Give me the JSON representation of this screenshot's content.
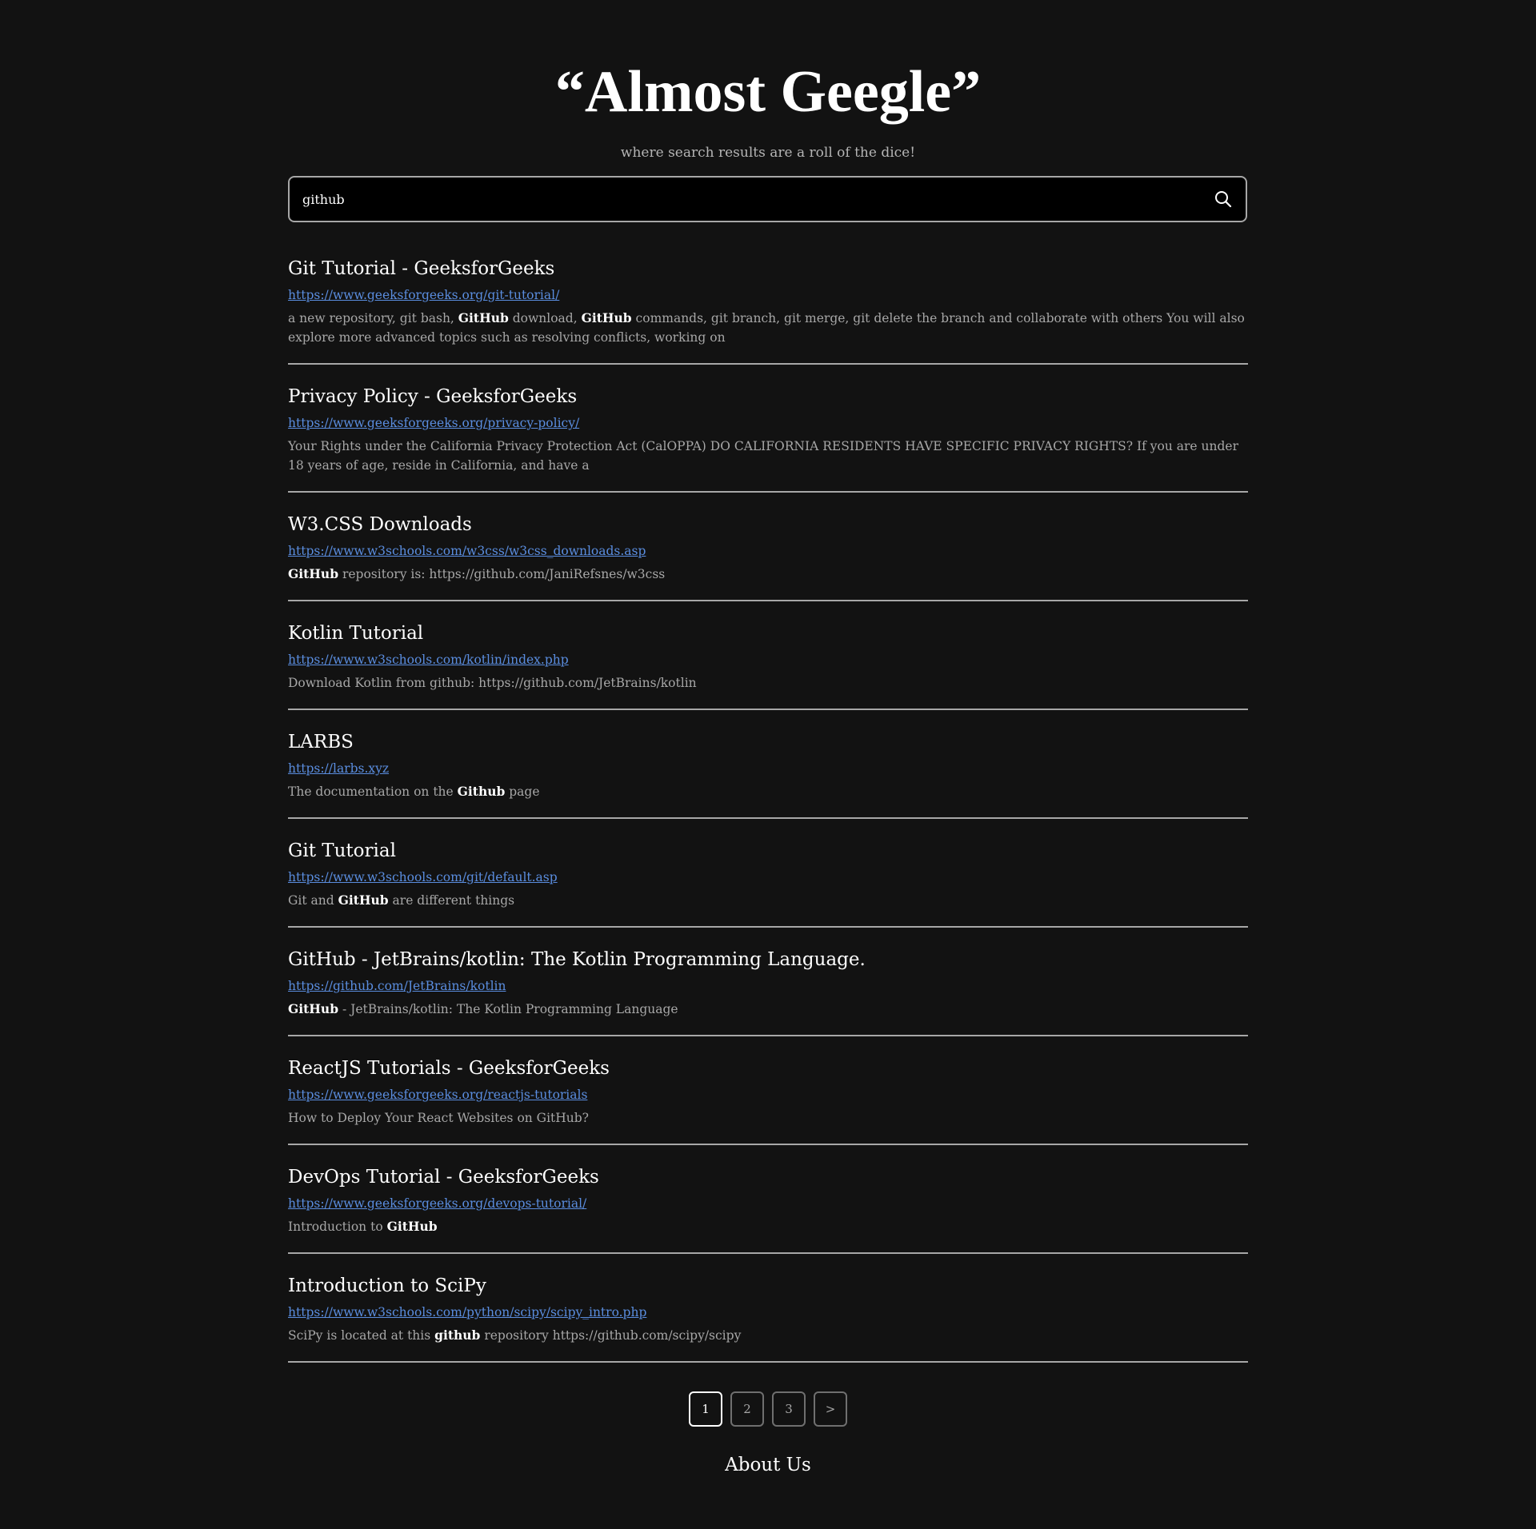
{
  "header": {
    "title": "“Almost Geegle”",
    "tagline": "where search results are a roll of the dice!"
  },
  "search": {
    "value": "github",
    "icon": "search-icon"
  },
  "results": [
    {
      "title": "Git Tutorial - GeeksforGeeks",
      "url": "https://www.geeksforgeeks.org/git-tutorial/",
      "snippet": [
        {
          "text": "a new repository, git bash, ",
          "bold": false
        },
        {
          "text": "GitHub",
          "bold": true
        },
        {
          "text": " download, ",
          "bold": false
        },
        {
          "text": "GitHub",
          "bold": true
        },
        {
          "text": " commands, git branch, git merge, git delete the branch and collaborate with others You will also explore more advanced topics such as resolving conflicts, working on",
          "bold": false
        }
      ]
    },
    {
      "title": "Privacy Policy - GeeksforGeeks",
      "url": "https://www.geeksforgeeks.org/privacy-policy/",
      "snippet": [
        {
          "text": "Your Rights under the California Privacy Protection Act (CalOPPA) DO CALIFORNIA RESIDENTS HAVE SPECIFIC PRIVACY RIGHTS? If you are under 18 years of age, reside in California, and have a",
          "bold": false
        }
      ]
    },
    {
      "title": "W3.CSS Downloads",
      "url": "https://www.w3schools.com/w3css/w3css_downloads.asp",
      "snippet": [
        {
          "text": "GitHub",
          "bold": true
        },
        {
          "text": " repository is: https://github.com/JaniRefsnes/w3css",
          "bold": false
        }
      ]
    },
    {
      "title": "Kotlin Tutorial",
      "url": "https://www.w3schools.com/kotlin/index.php",
      "snippet": [
        {
          "text": "Download Kotlin from github: https://github.com/JetBrains/kotlin",
          "bold": false
        }
      ]
    },
    {
      "title": "LARBS",
      "url": "https://larbs.xyz",
      "snippet": [
        {
          "text": "The documentation on the ",
          "bold": false
        },
        {
          "text": "Github",
          "bold": true
        },
        {
          "text": " page",
          "bold": false
        }
      ]
    },
    {
      "title": "Git Tutorial",
      "url": "https://www.w3schools.com/git/default.asp",
      "snippet": [
        {
          "text": "Git and ",
          "bold": false
        },
        {
          "text": "GitHub",
          "bold": true
        },
        {
          "text": " are different things",
          "bold": false
        }
      ]
    },
    {
      "title": "GitHub - JetBrains/kotlin: The Kotlin Programming Language.",
      "url": "https://github.com/JetBrains/kotlin",
      "snippet": [
        {
          "text": "GitHub",
          "bold": true
        },
        {
          "text": " - JetBrains/kotlin: The Kotlin Programming Language",
          "bold": false
        }
      ]
    },
    {
      "title": "ReactJS Tutorials - GeeksforGeeks",
      "url": "https://www.geeksforgeeks.org/reactjs-tutorials",
      "snippet": [
        {
          "text": "How to Deploy Your React Websites on GitHub?",
          "bold": false
        }
      ]
    },
    {
      "title": "DevOps Tutorial - GeeksforGeeks",
      "url": "https://www.geeksforgeeks.org/devops-tutorial/",
      "snippet": [
        {
          "text": "Introduction to ",
          "bold": false
        },
        {
          "text": "GitHub",
          "bold": true
        }
      ]
    },
    {
      "title": "Introduction to SciPy",
      "url": "https://www.w3schools.com/python/scipy/scipy_intro.php",
      "snippet": [
        {
          "text": "SciPy is located at this ",
          "bold": false
        },
        {
          "text": "github",
          "bold": true
        },
        {
          "text": " repository https://github.com/scipy/scipy",
          "bold": false
        }
      ]
    }
  ],
  "pagination": {
    "pages": [
      "1",
      "2",
      "3",
      ">"
    ],
    "active": "1"
  },
  "footer": {
    "about_heading": "About Us"
  },
  "colors": {
    "background": "#121212",
    "link": "#5a8ddf",
    "muted_text": "#a7a7a7",
    "divider": "#a7a7a7"
  }
}
